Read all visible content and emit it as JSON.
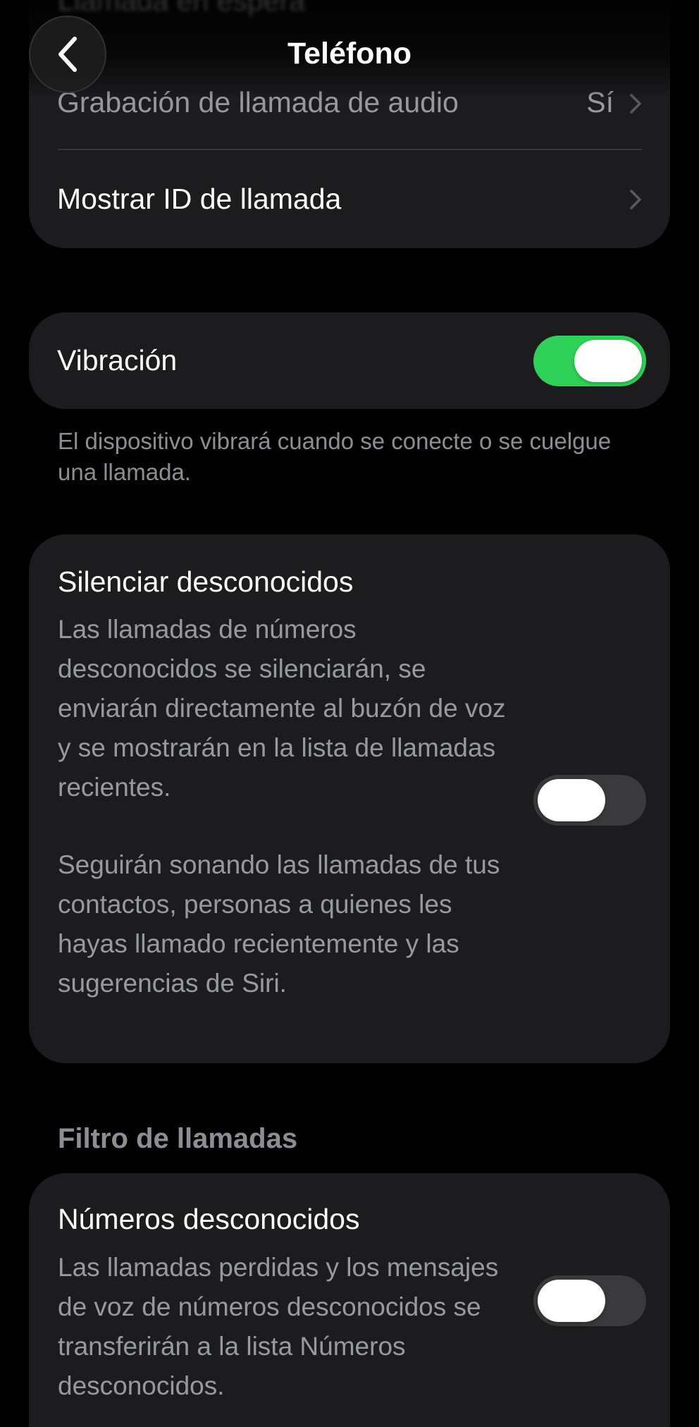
{
  "navbar": {
    "title": "Teléfono",
    "ghost_row_label": "Llamada en espera"
  },
  "group_calls": {
    "items": [
      {
        "label": "Grabación de llamada de audio",
        "value": "Sí"
      },
      {
        "label": "Mostrar ID de llamada"
      }
    ]
  },
  "vibration": {
    "label": "Vibración",
    "enabled": true,
    "footer": "El dispositivo vibrará cuando se conecte o se cuelgue una llamada."
  },
  "silence_unknown": {
    "title": "Silenciar desconocidos",
    "description_1": "Las llamadas de números desconocidos se silenciarán, se enviarán directamente al buzón de voz y se mostrarán en la lista de llamadas recientes.",
    "description_2": "Seguirán sonando las llamadas de tus contactos, personas a quienes les hayas llamado recientemente y las sugerencias de Siri.",
    "enabled": false
  },
  "call_filter": {
    "section_header": "Filtro de llamadas",
    "unknown_numbers": {
      "title": "Números desconocidos",
      "description": "Las llamadas perdidas y los mensajes de voz de números desconocidos se transferirán a la lista Números desconocidos.",
      "enabled": false
    }
  },
  "colors": {
    "background": "#000000",
    "cell_background": "#1c1c1e",
    "toggle_on": "#30d158",
    "toggle_off": "#3a3a3c",
    "secondary_text": "#8e8e93"
  },
  "icons": {
    "back": "chevron-left-icon",
    "disclosure": "chevron-right-icon"
  }
}
